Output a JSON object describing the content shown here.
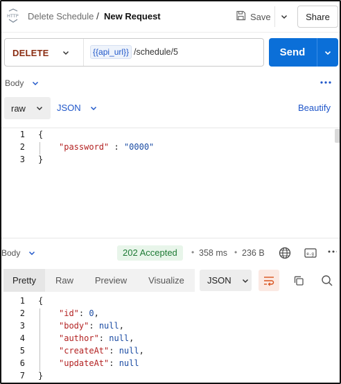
{
  "header": {
    "request_type_icon": "http-icon",
    "breadcrumb_parent": "Delete Schedule",
    "breadcrumb_separator": "/",
    "breadcrumb_current": "New Request",
    "save_label": "Save",
    "share_label": "Share"
  },
  "request": {
    "method": "DELETE",
    "url_variable": "{{api_url}}",
    "url_path": "/schedule/5",
    "send_label": "Send"
  },
  "request_body": {
    "section_label": "Body",
    "mode": "raw",
    "language": "JSON",
    "beautify_label": "Beautify",
    "line_numbers": [
      "1",
      "2",
      "3"
    ],
    "lines": [
      {
        "open": "{"
      },
      {
        "key": "\"password\"",
        "sep": " : ",
        "value": "\"0000\""
      },
      {
        "close": "}"
      }
    ]
  },
  "response": {
    "section_label": "Body",
    "status": "202 Accepted",
    "time": "358 ms",
    "size": "236 B",
    "tabs": [
      "Pretty",
      "Raw",
      "Preview",
      "Visualize"
    ],
    "active_tab": "Pretty",
    "format": "JSON",
    "line_numbers": [
      "1",
      "2",
      "3",
      "4",
      "5",
      "6",
      "7"
    ],
    "lines": [
      {
        "text": "{"
      },
      {
        "key": "\"id\"",
        "value": "0",
        "comma": ","
      },
      {
        "key": "\"body\"",
        "value": "null",
        "comma": ","
      },
      {
        "key": "\"author\"",
        "value": "null",
        "comma": ","
      },
      {
        "key": "\"createAt\"",
        "value": "null",
        "comma": ","
      },
      {
        "key": "\"updateAt\"",
        "value": "null",
        "comma": ""
      },
      {
        "text": "}"
      }
    ]
  },
  "colors": {
    "send_button": "#0b6fd8",
    "method_delete": "#8b2e13",
    "link_blue": "#1f56c9",
    "status_ok": "#1d7a34"
  }
}
